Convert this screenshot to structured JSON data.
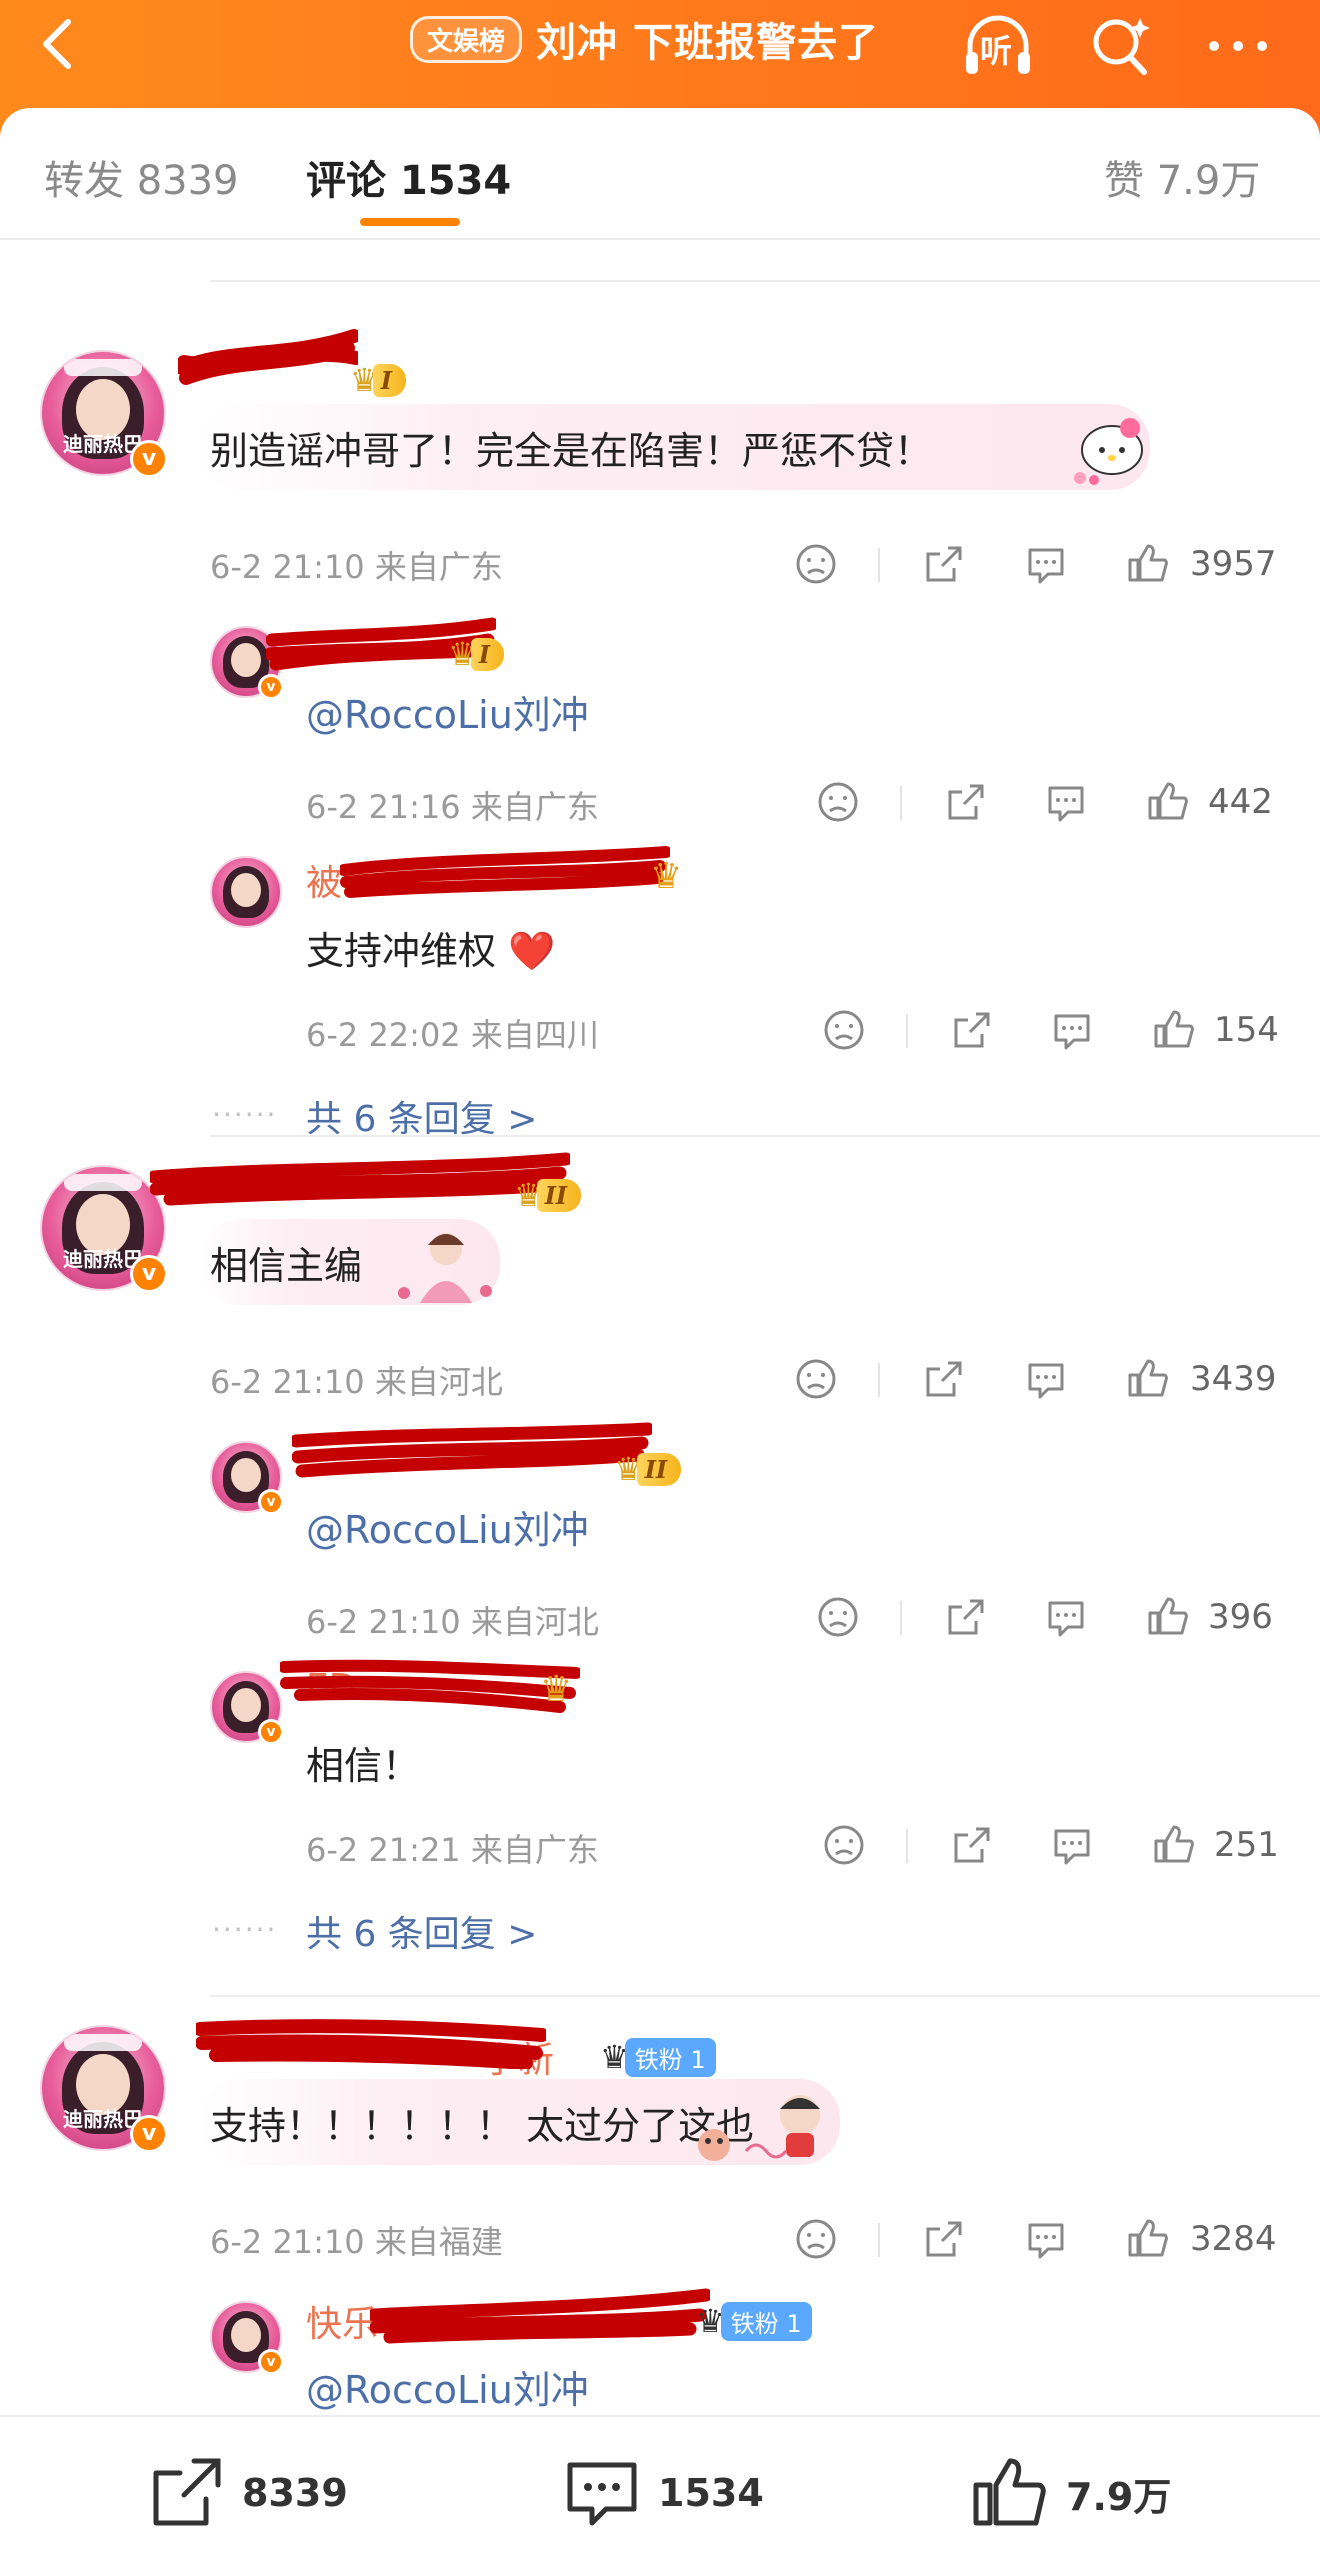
{
  "header": {
    "rank_tag": "文娱榜",
    "title": "刘冲 下班报警去了",
    "listen_label": "听"
  },
  "tabs": {
    "repost": "转发 8339",
    "comments": "评论 1534",
    "likes": "赞 7.9万"
  },
  "comments": [
    {
      "level_badge": "I",
      "avatar_text": "迪丽热巴",
      "text": "别造谣冲哥了！完全是在陷害！严惩不贷！",
      "time": "6-2 21:10",
      "location": "来自广东",
      "likes": "3957",
      "replies": [
        {
          "level_badge": "I",
          "mention": "@RoccoLiu刘冲",
          "time": "6-2 21:16",
          "location": "来自广东",
          "likes": "442"
        },
        {
          "name_visible": "被",
          "text": "支持冲维权",
          "emoji": "❤️",
          "time": "6-2 22:02",
          "location": "来自四川",
          "likes": "154"
        }
      ],
      "more_replies": "共 6 条回复 >"
    },
    {
      "level_badge": "II",
      "avatar_text": "迪丽热巴",
      "text": "相信主编",
      "time": "6-2 21:10",
      "location": "来自河北",
      "likes": "3439",
      "replies": [
        {
          "level_badge": "II",
          "mention": "@RoccoLiu刘冲",
          "time": "6-2 21:10",
          "location": "来自河北",
          "likes": "396"
        },
        {
          "name_visible": "ED",
          "text": "相信！",
          "time": "6-2 21:21",
          "location": "来自广东",
          "likes": "251"
        }
      ],
      "more_replies": "共 6 条回复 >"
    },
    {
      "fan_badge": "铁粉 1",
      "name_visible": "小新",
      "avatar_text": "迪丽热巴",
      "text": "支持！！！！！！ 太过分了这也",
      "time": "6-2 21:10",
      "location": "来自福建",
      "likes": "3284",
      "replies": [
        {
          "name_visible": "快乐",
          "fan_badge": "铁粉 1",
          "mention": "@RoccoLiu刘冲"
        }
      ]
    }
  ],
  "bottom": {
    "repost": "8339",
    "comments": "1534",
    "likes": "7.9万"
  },
  "colors": {
    "brand": "#ff8200",
    "username": "#eb7350",
    "link": "#4d6fa8",
    "redact": "#c40000"
  }
}
